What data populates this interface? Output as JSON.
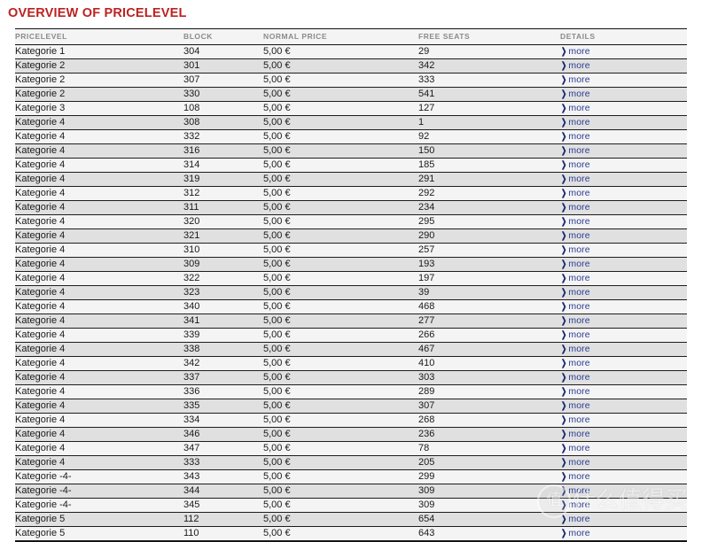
{
  "page": {
    "title": "OVERVIEW OF PRICELEVEL",
    "title_color": "#bb2222"
  },
  "table": {
    "columns": [
      {
        "key": "pricelevel",
        "label": "PRICELEVEL"
      },
      {
        "key": "block",
        "label": "BLOCK"
      },
      {
        "key": "price",
        "label": "NORMAL PRICE"
      },
      {
        "key": "seats",
        "label": "FREE SEATS"
      },
      {
        "key": "details",
        "label": "DETAILS"
      }
    ],
    "details_link": {
      "label": "more",
      "arrow": "❯",
      "color": "#2b3d91"
    },
    "row_colors": {
      "even": "#f4f4f4",
      "odd": "#e0e0e0"
    },
    "rows": [
      {
        "pricelevel": "Kategorie 1",
        "block": "304",
        "price": "5,00 €",
        "seats": "29"
      },
      {
        "pricelevel": "Kategorie 2",
        "block": "301",
        "price": "5,00 €",
        "seats": "342"
      },
      {
        "pricelevel": "Kategorie 2",
        "block": "307",
        "price": "5,00 €",
        "seats": "333"
      },
      {
        "pricelevel": "Kategorie 2",
        "block": "330",
        "price": "5,00 €",
        "seats": "541"
      },
      {
        "pricelevel": "Kategorie 3",
        "block": "108",
        "price": "5,00 €",
        "seats": "127"
      },
      {
        "pricelevel": "Kategorie 4",
        "block": "308",
        "price": "5,00 €",
        "seats": "1"
      },
      {
        "pricelevel": "Kategorie 4",
        "block": "332",
        "price": "5,00 €",
        "seats": "92"
      },
      {
        "pricelevel": "Kategorie 4",
        "block": "316",
        "price": "5,00 €",
        "seats": "150"
      },
      {
        "pricelevel": "Kategorie 4",
        "block": "314",
        "price": "5,00 €",
        "seats": "185"
      },
      {
        "pricelevel": "Kategorie 4",
        "block": "319",
        "price": "5,00 €",
        "seats": "291"
      },
      {
        "pricelevel": "Kategorie 4",
        "block": "312",
        "price": "5,00 €",
        "seats": "292"
      },
      {
        "pricelevel": "Kategorie 4",
        "block": "311",
        "price": "5,00 €",
        "seats": "234"
      },
      {
        "pricelevel": "Kategorie 4",
        "block": "320",
        "price": "5,00 €",
        "seats": "295"
      },
      {
        "pricelevel": "Kategorie 4",
        "block": "321",
        "price": "5,00 €",
        "seats": "290"
      },
      {
        "pricelevel": "Kategorie 4",
        "block": "310",
        "price": "5,00 €",
        "seats": "257"
      },
      {
        "pricelevel": "Kategorie 4",
        "block": "309",
        "price": "5,00 €",
        "seats": "193"
      },
      {
        "pricelevel": "Kategorie 4",
        "block": "322",
        "price": "5,00 €",
        "seats": "197"
      },
      {
        "pricelevel": "Kategorie 4",
        "block": "323",
        "price": "5,00 €",
        "seats": "39"
      },
      {
        "pricelevel": "Kategorie 4",
        "block": "340",
        "price": "5,00 €",
        "seats": "468"
      },
      {
        "pricelevel": "Kategorie 4",
        "block": "341",
        "price": "5,00 €",
        "seats": "277"
      },
      {
        "pricelevel": "Kategorie 4",
        "block": "339",
        "price": "5,00 €",
        "seats": "266"
      },
      {
        "pricelevel": "Kategorie 4",
        "block": "338",
        "price": "5,00 €",
        "seats": "467"
      },
      {
        "pricelevel": "Kategorie 4",
        "block": "342",
        "price": "5,00 €",
        "seats": "410"
      },
      {
        "pricelevel": "Kategorie 4",
        "block": "337",
        "price": "5,00 €",
        "seats": "303"
      },
      {
        "pricelevel": "Kategorie 4",
        "block": "336",
        "price": "5,00 €",
        "seats": "289"
      },
      {
        "pricelevel": "Kategorie 4",
        "block": "335",
        "price": "5,00 €",
        "seats": "307"
      },
      {
        "pricelevel": "Kategorie 4",
        "block": "334",
        "price": "5,00 €",
        "seats": "268"
      },
      {
        "pricelevel": "Kategorie 4",
        "block": "346",
        "price": "5,00 €",
        "seats": "236"
      },
      {
        "pricelevel": "Kategorie 4",
        "block": "347",
        "price": "5,00 €",
        "seats": "78"
      },
      {
        "pricelevel": "Kategorie 4",
        "block": "333",
        "price": "5,00 €",
        "seats": "205"
      },
      {
        "pricelevel": "Kategorie -4-",
        "block": "343",
        "price": "5,00 €",
        "seats": "299"
      },
      {
        "pricelevel": "Kategorie -4-",
        "block": "344",
        "price": "5,00 €",
        "seats": "309"
      },
      {
        "pricelevel": "Kategorie -4-",
        "block": "345",
        "price": "5,00 €",
        "seats": "309"
      },
      {
        "pricelevel": "Kategorie 5",
        "block": "112",
        "price": "5,00 €",
        "seats": "654"
      },
      {
        "pricelevel": "Kategorie 5",
        "block": "110",
        "price": "5,00 €",
        "seats": "643"
      }
    ]
  },
  "watermark": {
    "logo_char": "值",
    "text": "什么值得买"
  }
}
